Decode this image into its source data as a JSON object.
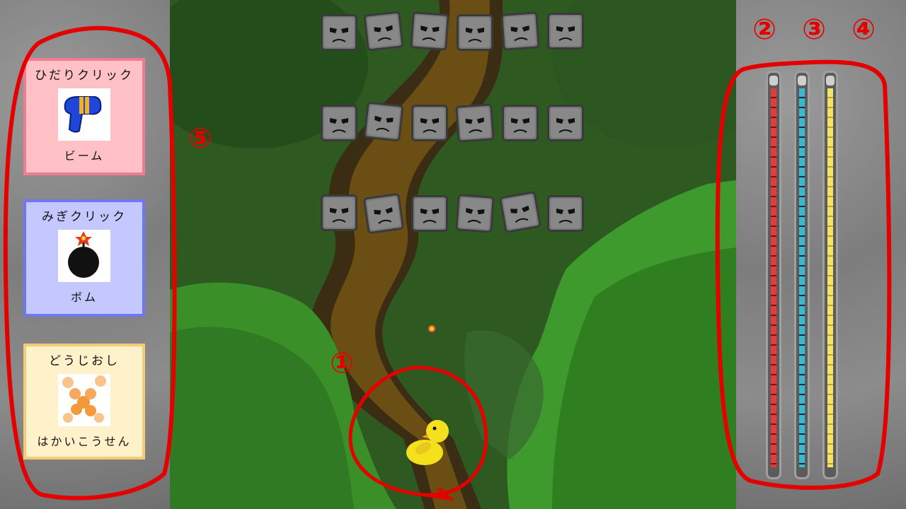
{
  "controls": {
    "left_click": {
      "title": "ひだりクリック",
      "weapon": "ビーム",
      "icon": "beam-gun-icon"
    },
    "right_click": {
      "title": "みぎクリック",
      "weapon": "ボム",
      "icon": "bomb-icon"
    },
    "both_click": {
      "title": "どうじおし",
      "weapon": "はかいこうせん",
      "icon": "destruction-beam-icon"
    }
  },
  "labels": {
    "player_marker": "①",
    "health_marker": "②",
    "charge_marker": "③",
    "special_marker": "④",
    "controls_marker": "⑤"
  },
  "gauges": [
    {
      "id": "health",
      "icon": "heart-icon",
      "color": "#e23c3c",
      "level": 1.0
    },
    {
      "id": "charge",
      "icon": "charge-segment-icon",
      "color": "#3fb6cf",
      "level": 1.0
    },
    {
      "id": "special",
      "icon": "star-icon",
      "color": "#f2e36a",
      "level": 1.0
    }
  ],
  "enemies": {
    "rows": 3,
    "cols": 6,
    "icon": "stone-block-face-icon"
  },
  "player": {
    "icon": "yellow-duck-icon"
  },
  "colors": {
    "highlight": "#e50000",
    "panel": "#858585"
  }
}
